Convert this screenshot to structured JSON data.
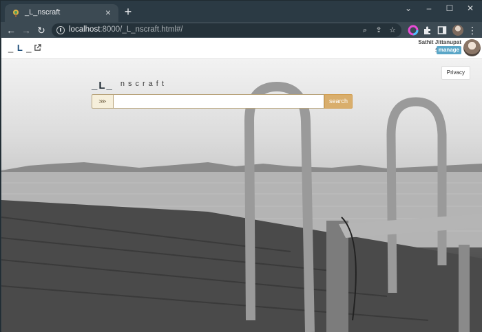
{
  "browser": {
    "tab_title": "_L_nscraft",
    "url_host": "localhost",
    "url_rest": ":8000/_L_nscraft.html#/",
    "window_controls": [
      "minimize-icon",
      "maximize-icon",
      "close-icon"
    ],
    "toolbar_icons": [
      "back-icon",
      "forward-icon",
      "reload-icon",
      "zoom-icon",
      "share-icon",
      "bookmark-star-icon",
      "extension-color-icon",
      "extensions-puzzle-icon",
      "side-panel-icon",
      "profile-avatar",
      "menu-icon"
    ]
  },
  "app": {
    "logo_small": "L",
    "logo_small_prefix": "_",
    "logo_small_suffix": "_",
    "user_name": "Sathit Jittanupat",
    "user_org": "SU",
    "manage_label": "manage"
  },
  "hero": {
    "privacy_label": "Privacy",
    "brand_mark": "_L_",
    "brand_word": "nscraft",
    "search_prefix": "⋙",
    "search_value": "",
    "search_button": "search"
  },
  "colors": {
    "browser_frame": "#2b3a44",
    "toolbar": "#3c4a53",
    "logo_blue": "#1d4e7a",
    "manage_badge": "#5aa6c7",
    "search_button": "#d9ae6c",
    "search_prefix_bg": "#f6efdb"
  }
}
